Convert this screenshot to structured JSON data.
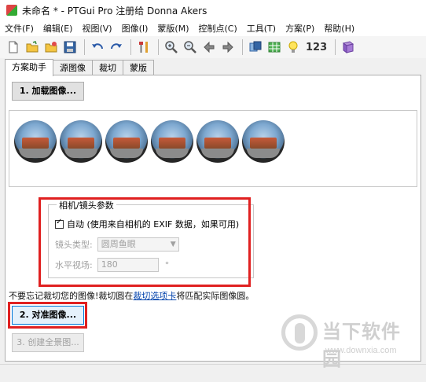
{
  "window": {
    "title": "未命名 * - PTGui Pro 注册给 Donna Akers"
  },
  "menu": [
    "文件(F)",
    "编辑(E)",
    "视图(V)",
    "图像(I)",
    "蒙版(M)",
    "控制点(C)",
    "工具(T)",
    "方案(P)",
    "帮助(H)"
  ],
  "toolbar": {
    "icons": [
      "new-icon",
      "open-icon",
      "open-template-icon",
      "save-icon",
      "undo-icon",
      "redo-icon",
      "tools-icon",
      "zoom-in-icon",
      "zoom-out-icon",
      "arrow-left-icon",
      "arrow-right-icon",
      "panorama-editor-icon",
      "table-icon",
      "bulb-icon",
      "numbers-icon",
      "book-icon"
    ],
    "numbers_label": "123"
  },
  "tabs": [
    "方案助手",
    "源图像",
    "裁切",
    "蒙版"
  ],
  "buttons": {
    "load": "1. 加载图像...",
    "align": "2. 对准图像...",
    "create": "3. 创建全景图..."
  },
  "camera": {
    "group_title": "相机/镜头参数",
    "auto_label": "自动 (使用来自相机的 EXIF 数据，如果可用)",
    "auto_checked": true,
    "lens_type_label": "镜头类型:",
    "lens_type_value": "圆周鱼眼",
    "fov_label": "水平视场:",
    "fov_value": "180",
    "fov_unit": "°"
  },
  "note": {
    "pre": "不要忘记裁切您的图像!裁切圆在",
    "link": "裁切选项卡",
    "post": "将匹配实际图像圆。"
  },
  "watermark": {
    "text": "当下软件园",
    "url": "www.downxia.com"
  }
}
